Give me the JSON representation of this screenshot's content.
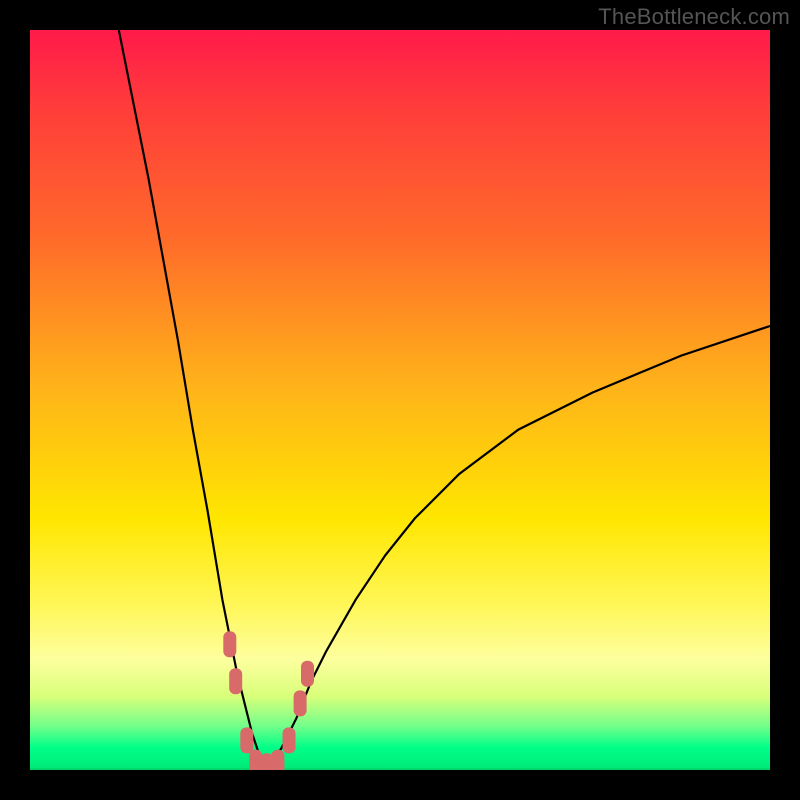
{
  "watermark": "TheBottleneck.com",
  "colors": {
    "frame": "#000000",
    "curve": "#000000",
    "marker": "#d86a6a",
    "gradient_top": "#ff1a4a",
    "gradient_bottom": "#00e876"
  },
  "chart_data": {
    "type": "line",
    "title": "",
    "xlabel": "",
    "ylabel": "",
    "xlim": [
      0,
      100
    ],
    "ylim": [
      0,
      100
    ],
    "grid": false,
    "legend": false,
    "annotations": [],
    "description": "Bottleneck curves: left branch descends steeply from top-left to a minimum near x≈32 y≈0, right branch rises toward upper-right reaching y≈60 at x=100. Pink capsule markers sit along the trough region.",
    "series": [
      {
        "name": "left-branch",
        "x": [
          12,
          14,
          16,
          18,
          20,
          22,
          24,
          26,
          27,
          28,
          29,
          30,
          31,
          32
        ],
        "y": [
          100,
          90,
          80,
          69,
          58,
          46,
          35,
          23,
          18,
          13,
          9,
          5,
          2,
          0
        ]
      },
      {
        "name": "right-branch",
        "x": [
          32,
          34,
          36,
          38,
          40,
          44,
          48,
          52,
          58,
          66,
          76,
          88,
          100
        ],
        "y": [
          0,
          3,
          7,
          12,
          16,
          23,
          29,
          34,
          40,
          46,
          51,
          56,
          60
        ]
      }
    ],
    "trough_markers": {
      "comment": "approximate positions of the pink rounded markers near the curve minimum, as (x,y)",
      "points": [
        [
          27.0,
          17.0
        ],
        [
          27.8,
          12.0
        ],
        [
          29.3,
          4.0
        ],
        [
          30.5,
          1.0
        ],
        [
          32.0,
          0.5
        ],
        [
          33.5,
          1.0
        ],
        [
          35.0,
          4.0
        ],
        [
          36.5,
          9.0
        ],
        [
          37.5,
          13.0
        ]
      ]
    }
  }
}
